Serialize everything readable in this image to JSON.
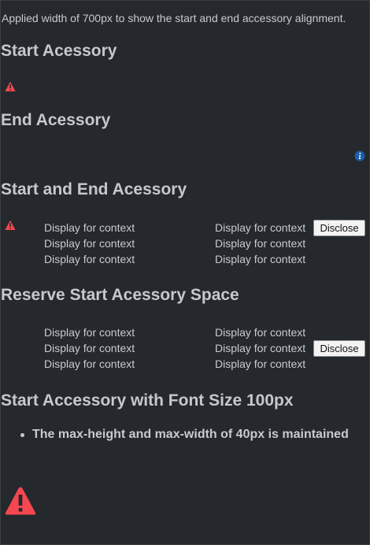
{
  "intro": "Applied width of 700px to show the start and end accessory alignment.",
  "sections": [
    {
      "title": "Start Acessory"
    },
    {
      "title": "End Acessory"
    },
    {
      "title": "Start and End Acessory"
    },
    {
      "title": "Reserve Start Acessory Space"
    },
    {
      "title": "Start Accessory with Font Size 100px"
    }
  ],
  "context_text": "Display for context",
  "button_label": "Disclose",
  "bullet_item": "The max-height and max-width of 40px is maintained",
  "colors": {
    "warning": "#f5474f",
    "info": "#1b5fa6",
    "background": "#25282c",
    "heading": "#c5c9ce"
  },
  "icons": {
    "warning": "warning-triangle-icon",
    "info": "info-circle-icon"
  }
}
